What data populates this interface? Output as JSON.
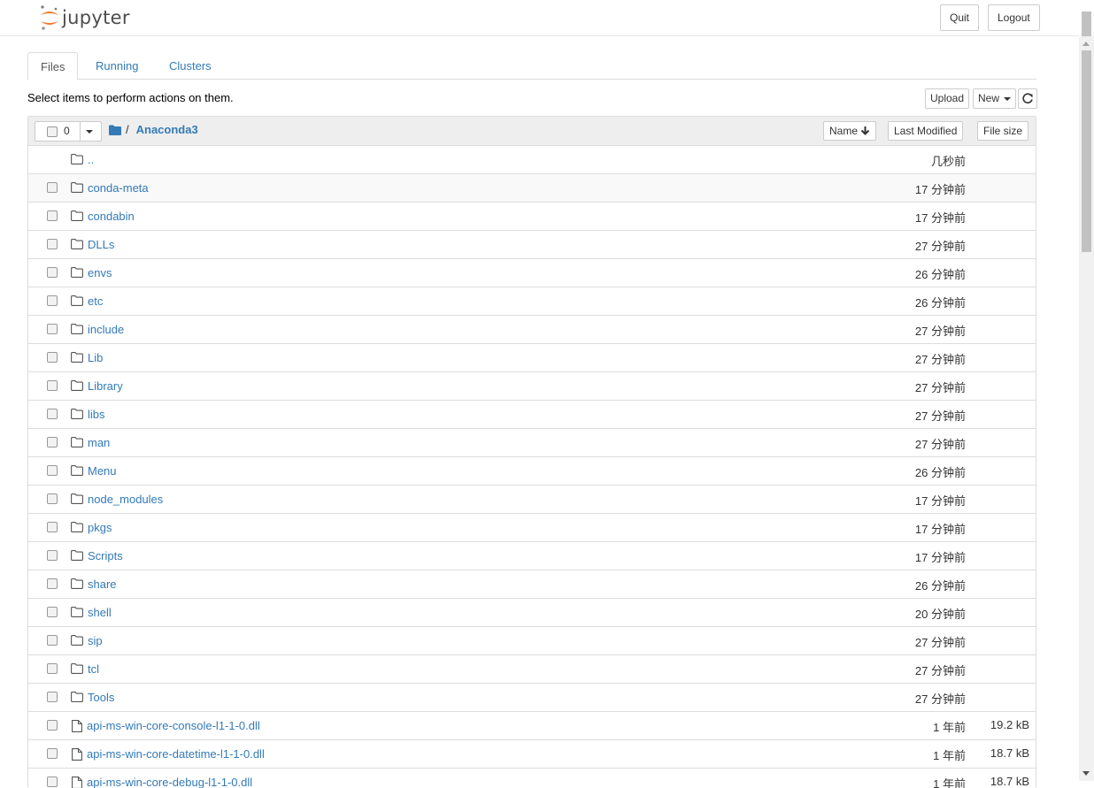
{
  "header": {
    "logo_text": "jupyter",
    "quit_label": "Quit",
    "logout_label": "Logout"
  },
  "tabs": [
    {
      "label": "Files",
      "active": true
    },
    {
      "label": "Running",
      "active": false
    },
    {
      "label": "Clusters",
      "active": false
    }
  ],
  "toolbar": {
    "hint": "Select items to perform actions on them.",
    "upload_label": "Upload",
    "new_label": "New",
    "refresh_icon": "refresh-icon"
  },
  "list_header": {
    "selected_count": "0",
    "breadcrumb_root": "/",
    "breadcrumb_folder": "Anaconda3",
    "sort_name_label": "Name",
    "sort_modified_label": "Last Modified",
    "sort_size_label": "File size"
  },
  "items": [
    {
      "type": "up",
      "name": "..",
      "modified": "几秒前",
      "size": ""
    },
    {
      "type": "folder",
      "name": "conda-meta",
      "modified": "17 分钟前",
      "size": ""
    },
    {
      "type": "folder",
      "name": "condabin",
      "modified": "17 分钟前",
      "size": ""
    },
    {
      "type": "folder",
      "name": "DLLs",
      "modified": "27 分钟前",
      "size": ""
    },
    {
      "type": "folder",
      "name": "envs",
      "modified": "26 分钟前",
      "size": ""
    },
    {
      "type": "folder",
      "name": "etc",
      "modified": "26 分钟前",
      "size": ""
    },
    {
      "type": "folder",
      "name": "include",
      "modified": "27 分钟前",
      "size": ""
    },
    {
      "type": "folder",
      "name": "Lib",
      "modified": "27 分钟前",
      "size": ""
    },
    {
      "type": "folder",
      "name": "Library",
      "modified": "27 分钟前",
      "size": ""
    },
    {
      "type": "folder",
      "name": "libs",
      "modified": "27 分钟前",
      "size": ""
    },
    {
      "type": "folder",
      "name": "man",
      "modified": "27 分钟前",
      "size": ""
    },
    {
      "type": "folder",
      "name": "Menu",
      "modified": "26 分钟前",
      "size": ""
    },
    {
      "type": "folder",
      "name": "node_modules",
      "modified": "17 分钟前",
      "size": ""
    },
    {
      "type": "folder",
      "name": "pkgs",
      "modified": "17 分钟前",
      "size": ""
    },
    {
      "type": "folder",
      "name": "Scripts",
      "modified": "17 分钟前",
      "size": ""
    },
    {
      "type": "folder",
      "name": "share",
      "modified": "26 分钟前",
      "size": ""
    },
    {
      "type": "folder",
      "name": "shell",
      "modified": "20 分钟前",
      "size": ""
    },
    {
      "type": "folder",
      "name": "sip",
      "modified": "27 分钟前",
      "size": ""
    },
    {
      "type": "folder",
      "name": "tcl",
      "modified": "27 分钟前",
      "size": ""
    },
    {
      "type": "folder",
      "name": "Tools",
      "modified": "27 分钟前",
      "size": ""
    },
    {
      "type": "file",
      "name": "api-ms-win-core-console-l1-1-0.dll",
      "modified": "1 年前",
      "size": "19.2 kB"
    },
    {
      "type": "file",
      "name": "api-ms-win-core-datetime-l1-1-0.dll",
      "modified": "1 年前",
      "size": "18.7 kB"
    },
    {
      "type": "file",
      "name": "api-ms-win-core-debug-l1-1-0.dll",
      "modified": "1 年前",
      "size": "18.7 kB"
    }
  ],
  "colors": {
    "link": "#337ab7",
    "logo_orange": "#f37726"
  }
}
